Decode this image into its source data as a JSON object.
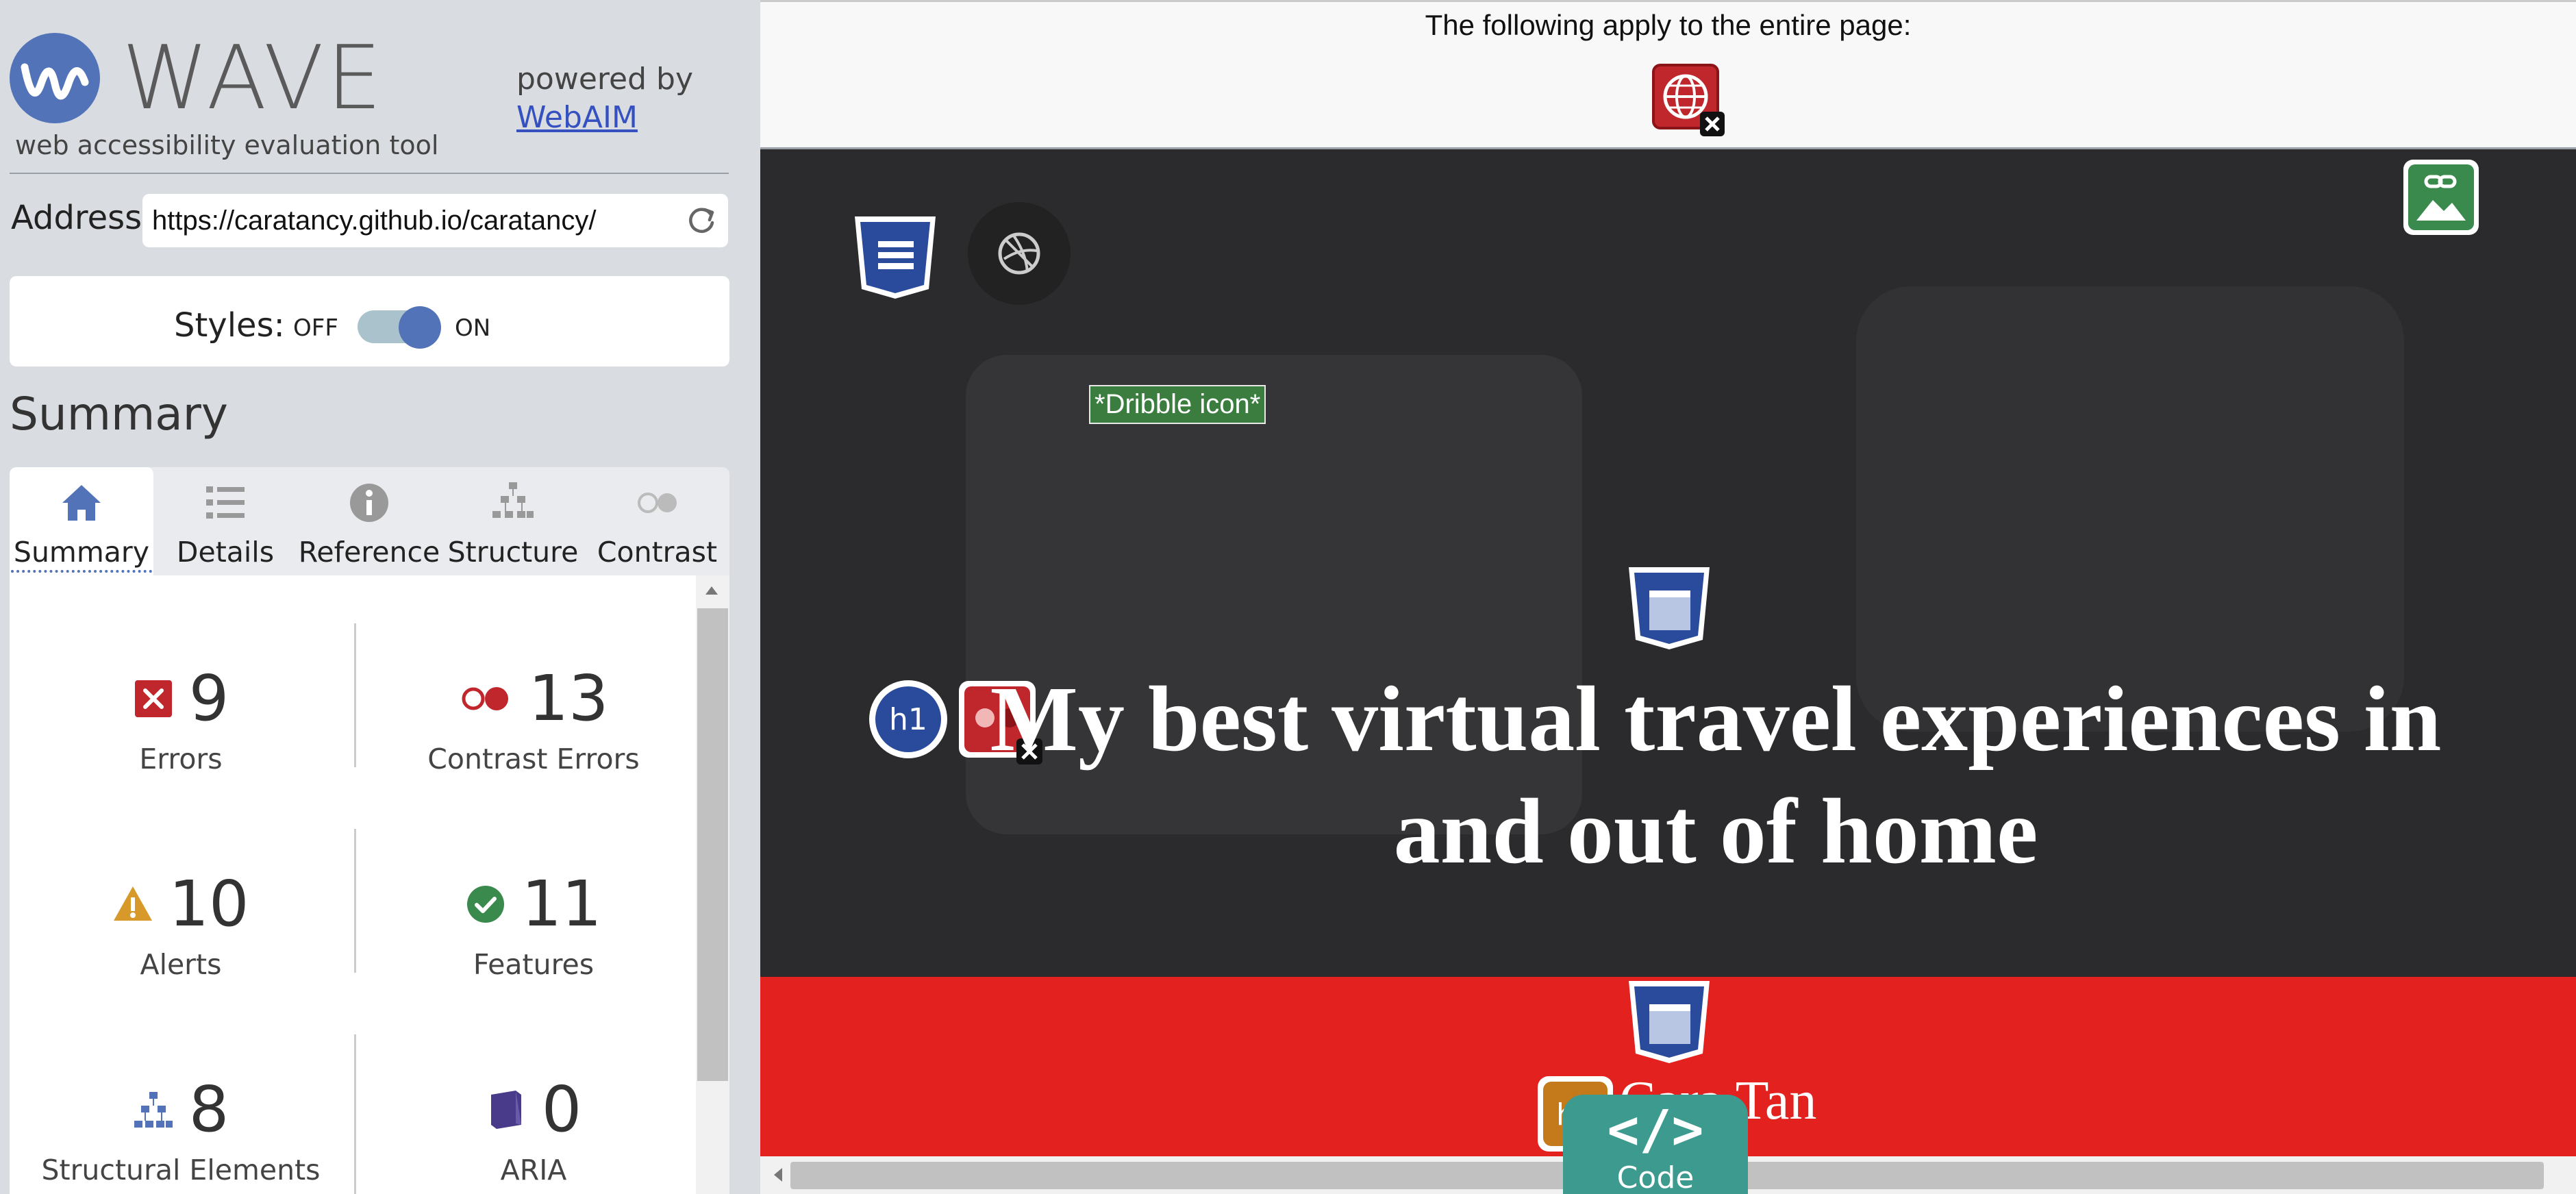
{
  "sidebar": {
    "logo_text": "WAVE",
    "tagline": "web accessibility evaluation tool",
    "powered_by": "powered by",
    "webaim_link": "WebAIM",
    "address_label": "Address:",
    "address_value": "https://caratancy.github.io/caratancy/",
    "styles_label": "Styles:",
    "styles_off": "OFF",
    "styles_on": "ON",
    "summary_heading": "Summary",
    "tabs": [
      {
        "label": "Summary",
        "icon": "home-icon",
        "active": true
      },
      {
        "label": "Details",
        "icon": "list-icon",
        "active": false
      },
      {
        "label": "Reference",
        "icon": "info-icon",
        "active": false
      },
      {
        "label": "Structure",
        "icon": "hierarchy-icon",
        "active": false
      },
      {
        "label": "Contrast",
        "icon": "contrast-icon",
        "active": false
      }
    ],
    "stats": {
      "errors": {
        "value": "9",
        "label": "Errors"
      },
      "contrast_errors": {
        "value": "13",
        "label": "Contrast Errors"
      },
      "alerts": {
        "value": "10",
        "label": "Alerts"
      },
      "features": {
        "value": "11",
        "label": "Features"
      },
      "structural": {
        "value": "8",
        "label": "Structural Elements"
      },
      "aria": {
        "value": "0",
        "label": "ARIA"
      }
    }
  },
  "page": {
    "top_notice": "The following apply to the entire page:",
    "dribble_alt": "*Dribble icon*",
    "hero_title": "My best virtual travel experiences in and out of home",
    "author": "Cara Tan",
    "code_label": "Code",
    "code_glyph": "</>"
  },
  "colors": {
    "accent": "#5273b8",
    "error": "#c0272d",
    "alert": "#d6992a",
    "feature": "#3a8a4e",
    "aria": "#4a3a8a",
    "hero_bg": "#2b2b2e",
    "red_band": "#e3211f",
    "code_btn": "#3d9a8e"
  }
}
